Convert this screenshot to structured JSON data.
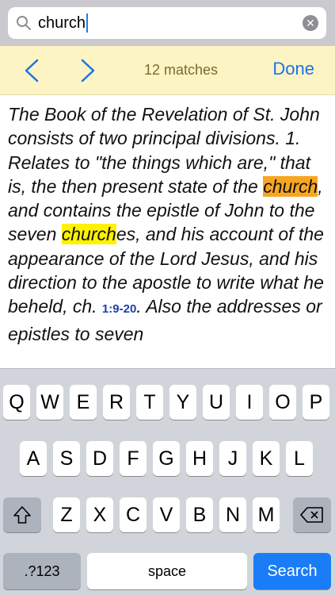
{
  "search": {
    "value": "church",
    "icon": "search-icon",
    "clear_icon": "clear-icon"
  },
  "find_bar": {
    "prev_icon": "chevron-left-icon",
    "next_icon": "chevron-right-icon",
    "matches_label": "12 matches",
    "done_label": "Done"
  },
  "content": {
    "segments": [
      {
        "text": "The Book of the Revelation of St. John consists of two principal divisions. 1. Relates to \"the things which are,\" that is, the then present state of the ",
        "style": "plain"
      },
      {
        "text": "church",
        "style": "current"
      },
      {
        "text": ", and contains the epistle of John to the seven ",
        "style": "plain"
      },
      {
        "text": "church",
        "style": "match"
      },
      {
        "text": "es, and his account of the appearance of the Lord Jesus, and his direction to the apostle to write what he beheld, ch. ",
        "style": "plain"
      },
      {
        "text": "1:9-20",
        "style": "ref"
      },
      {
        "text": ". Also the addresses or epistles to seven",
        "style": "plain"
      }
    ]
  },
  "keyboard": {
    "row1": [
      "Q",
      "W",
      "E",
      "R",
      "T",
      "Y",
      "U",
      "I",
      "O",
      "P"
    ],
    "row2": [
      "A",
      "S",
      "D",
      "F",
      "G",
      "H",
      "J",
      "K",
      "L"
    ],
    "row3": [
      "Z",
      "X",
      "C",
      "V",
      "B",
      "N",
      "M"
    ],
    "shift_icon": "shift-icon",
    "delete_icon": "delete-icon",
    "numbers_label": ".?123",
    "space_label": "space",
    "search_label": "Search"
  },
  "colors": {
    "current_highlight": "#f6a623",
    "match_highlight": "#fff200",
    "accent": "#1a73e8",
    "find_bar_bg": "#fdf4c4"
  }
}
